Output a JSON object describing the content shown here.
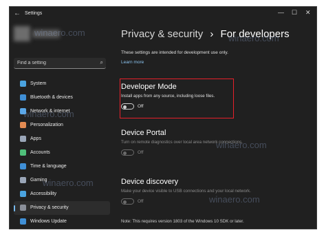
{
  "window": {
    "title": "Settings",
    "back_glyph": "←",
    "minimize_glyph": "—",
    "maximize_glyph": "☐",
    "close_glyph": "✕"
  },
  "search": {
    "placeholder": "Find a setting"
  },
  "sidebar": {
    "items": [
      {
        "label": "System",
        "icon": "system-icon",
        "color": "#4aa3df"
      },
      {
        "label": "Bluetooth & devices",
        "icon": "bluetooth-icon",
        "color": "#3f8fd6"
      },
      {
        "label": "Network & internet",
        "icon": "wifi-icon",
        "color": "#5aa7e8"
      },
      {
        "label": "Personalization",
        "icon": "brush-icon",
        "color": "#e38b52"
      },
      {
        "label": "Apps",
        "icon": "apps-icon",
        "color": "#9aa6b8"
      },
      {
        "label": "Accounts",
        "icon": "person-icon",
        "color": "#4fbf7a"
      },
      {
        "label": "Time & language",
        "icon": "clock-globe-icon",
        "color": "#3f8fd6"
      },
      {
        "label": "Gaming",
        "icon": "gamepad-icon",
        "color": "#9aa6b8"
      },
      {
        "label": "Accessibility",
        "icon": "accessibility-icon",
        "color": "#4aa3df"
      },
      {
        "label": "Privacy & security",
        "icon": "shield-icon",
        "color": "#8a8f99"
      },
      {
        "label": "Windows Update",
        "icon": "update-icon",
        "color": "#3f8fd6"
      }
    ],
    "selected_index": 9,
    "accent": "#76b9ed"
  },
  "breadcrumb": {
    "parent": "Privacy & security",
    "separator": "›",
    "current": "For developers"
  },
  "intro": {
    "text": "These settings are intended for development use only.",
    "link": "Learn more"
  },
  "sections": {
    "developer_mode": {
      "title": "Developer Mode",
      "description": "Install apps from any source, including loose files.",
      "toggle_state": "Off"
    },
    "device_portal": {
      "title": "Device Portal",
      "description": "Turn on remote diagnostics over local area network connections.",
      "toggle_state": "Off"
    },
    "device_discovery": {
      "title": "Device discovery",
      "description": "Make your device visible to USB connections and your local network.",
      "toggle_state": "Off"
    }
  },
  "note": "Note: This requires version 1803 of the Windows 10 SDK or later.",
  "watermark": "winaero.com",
  "highlight_color": "#e8202a"
}
